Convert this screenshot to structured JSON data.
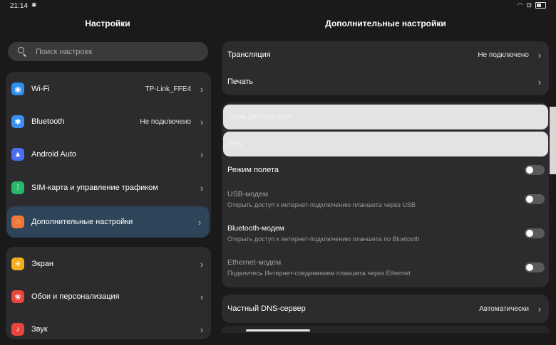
{
  "status_bar": {
    "time": "21:14",
    "bluetooth_icon": "bluetooth-icon",
    "right_icons": [
      "wifi-icon",
      "battery-saver-icon",
      "battery-icon"
    ]
  },
  "left_pane": {
    "title": "Настройки",
    "search_placeholder": "Поиск настроек",
    "group_1": [
      {
        "label": "Wi-Fi",
        "value": "TP-Link_FFE4",
        "icon": "wifi-icon",
        "color": "#2f8ff0"
      },
      {
        "label": "Bluetooth",
        "value": "Не подключено",
        "icon": "bluetooth-icon",
        "color": "#3b8df0"
      },
      {
        "label": "Android Auto",
        "value": "",
        "icon": "android-auto-icon",
        "color": "#4a6ff0"
      },
      {
        "label": "SIM-карта и управление трафиком",
        "value": "",
        "icon": "sim-icon",
        "color": "#27b86a"
      },
      {
        "label": "Дополнительные настройки",
        "value": "",
        "icon": "more-settings-icon",
        "color": "#f0763a"
      }
    ],
    "group_2": [
      {
        "label": "Экран",
        "icon": "display-icon",
        "color": "#f2b01e"
      },
      {
        "label": "Обои и персонализация",
        "icon": "wallpaper-icon",
        "color": "#e8453c"
      },
      {
        "label": "Звук",
        "icon": "sound-icon",
        "color": "#e8453c"
      }
    ]
  },
  "right_pane": {
    "title": "Дополнительные настройки",
    "card_1": [
      {
        "label": "Трансляция",
        "value": "Не подключено"
      },
      {
        "label": "Печать",
        "value": ""
      }
    ],
    "highlighted": [
      {
        "label": "Точка доступа Wi-Fi"
      },
      {
        "label": "VPN"
      }
    ],
    "airplane": {
      "label": "Режим полета"
    },
    "usb_modem": {
      "title": "USB-модем",
      "subtitle": "Открыть доступ к интернет-подключению планшета через USB"
    },
    "bt_modem": {
      "title": "Bluetooth-модем",
      "subtitle": "Открыть доступ к интернет-подключению планшета по Bluetooth"
    },
    "eth_modem": {
      "title": "Ethernet-модем",
      "subtitle": "Поделитесь Интернет-соединением планшета через Ethernet"
    },
    "dns": {
      "label": "Частный DNS-сервер",
      "value": "Автоматически"
    }
  },
  "colors": {
    "background": "#1a1a1a",
    "card": "#2c2c2e",
    "active_row": "#2e4559"
  }
}
